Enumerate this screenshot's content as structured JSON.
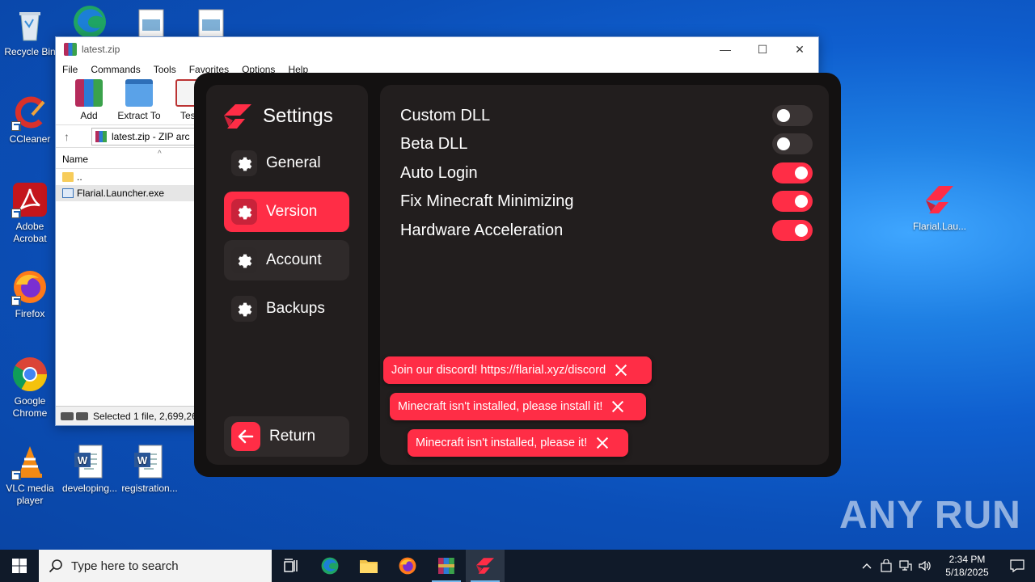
{
  "desktop": {
    "icons": [
      {
        "label": "Recycle Bin"
      },
      {
        "label": "CCleaner"
      },
      {
        "label": "Adobe Acrobat"
      },
      {
        "label": "Firefox"
      },
      {
        "label": "Google Chrome"
      },
      {
        "label": "VLC media player"
      },
      {
        "label": "developing..."
      },
      {
        "label": "registration..."
      },
      {
        "label": "Flarial.Lau..."
      }
    ]
  },
  "winrar": {
    "title": "latest.zip",
    "menu": [
      "File",
      "Commands",
      "Tools",
      "Favorites",
      "Options",
      "Help"
    ],
    "toolbar": [
      "Add",
      "Extract To",
      "Test"
    ],
    "address": "latest.zip - ZIP arc",
    "column_name": "Name",
    "rows": [
      "..",
      "Flarial.Launcher.exe"
    ],
    "status": "Selected 1 file, 2,699,264"
  },
  "launcher": {
    "title": "Settings",
    "nav": [
      {
        "label": "General",
        "state": "normal"
      },
      {
        "label": "Version",
        "state": "active"
      },
      {
        "label": "Account",
        "state": "hover"
      },
      {
        "label": "Backups",
        "state": "normal"
      }
    ],
    "return_label": "Return",
    "settings": [
      {
        "label": "Custom DLL",
        "enabled": false
      },
      {
        "label": "Beta DLL",
        "enabled": false
      },
      {
        "label": "Auto Login",
        "enabled": true
      },
      {
        "label": "Fix Minecraft Minimizing",
        "enabled": true
      },
      {
        "label": "Hardware Acceleration",
        "enabled": true
      }
    ],
    "toasts": [
      "Join our discord! https://flarial.xyz/discord",
      "Minecraft isn't installed, please install it!",
      "Minecraft isn't installed, please it!"
    ],
    "accent_color": "#ff2d46"
  },
  "taskbar": {
    "search_placeholder": "Type here to search",
    "time": "2:34 PM",
    "date": "5/18/2025"
  },
  "watermark": "ANY RUN"
}
